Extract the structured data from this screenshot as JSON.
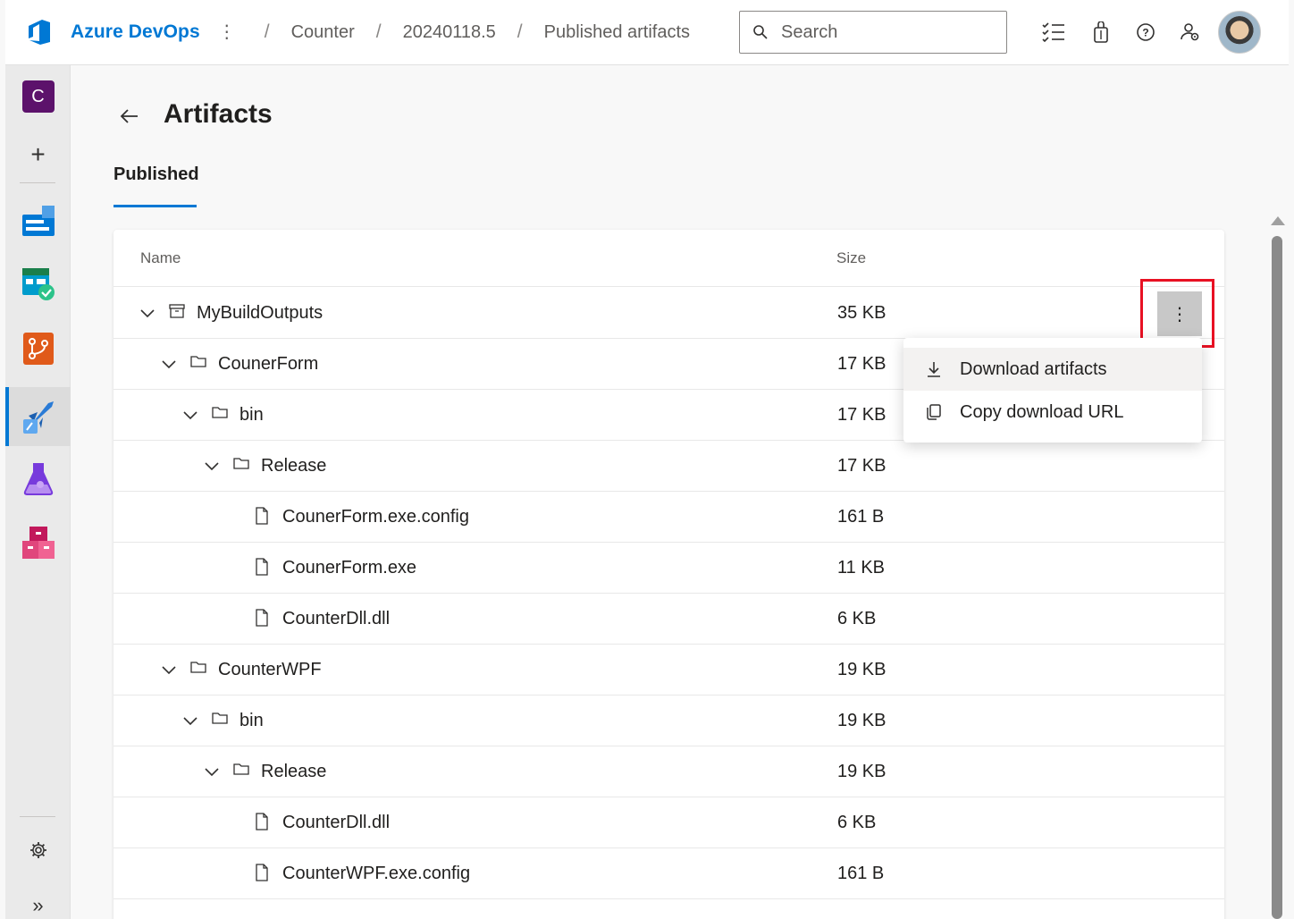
{
  "header": {
    "brand": "Azure DevOps",
    "breadcrumbs": [
      "Counter",
      "20240118.5",
      "Published artifacts"
    ],
    "search_placeholder": "Search"
  },
  "leftnav": {
    "org_initial": "C",
    "items": [
      "organization",
      "new",
      "boards",
      "test-plans-check",
      "repos",
      "pipelines",
      "test-plans",
      "artifacts",
      "settings",
      "expand"
    ]
  },
  "page": {
    "title": "Artifacts",
    "tab": "Published"
  },
  "table": {
    "columns": {
      "name": "Name",
      "size": "Size"
    },
    "rows": [
      {
        "name": "MyBuildOutputs",
        "size": "35 KB",
        "type": "artifact",
        "depth": 0
      },
      {
        "name": "CounerForm",
        "size": "17 KB",
        "type": "folder",
        "depth": 1
      },
      {
        "name": "bin",
        "size": "17 KB",
        "type": "folder",
        "depth": 2
      },
      {
        "name": "Release",
        "size": "17 KB",
        "type": "folder",
        "depth": 3
      },
      {
        "name": "CounerForm.exe.config",
        "size": "161 B",
        "type": "file",
        "depth": 4
      },
      {
        "name": "CounerForm.exe",
        "size": "11 KB",
        "type": "file",
        "depth": 4
      },
      {
        "name": "CounterDll.dll",
        "size": "6 KB",
        "type": "file",
        "depth": 4
      },
      {
        "name": "CounterWPF",
        "size": "19 KB",
        "type": "folder",
        "depth": 1
      },
      {
        "name": "bin",
        "size": "19 KB",
        "type": "folder",
        "depth": 2
      },
      {
        "name": "Release",
        "size": "19 KB",
        "type": "folder",
        "depth": 3
      },
      {
        "name": "CounterDll.dll",
        "size": "6 KB",
        "type": "file",
        "depth": 4
      },
      {
        "name": "CounterWPF.exe.config",
        "size": "161 B",
        "type": "file",
        "depth": 4
      }
    ]
  },
  "context_menu": {
    "items": [
      {
        "label": "Download artifacts",
        "icon": "download-icon"
      },
      {
        "label": "Copy download URL",
        "icon": "copy-icon"
      }
    ]
  },
  "colors": {
    "accent": "#0078d4",
    "highlight": "#e81123"
  }
}
